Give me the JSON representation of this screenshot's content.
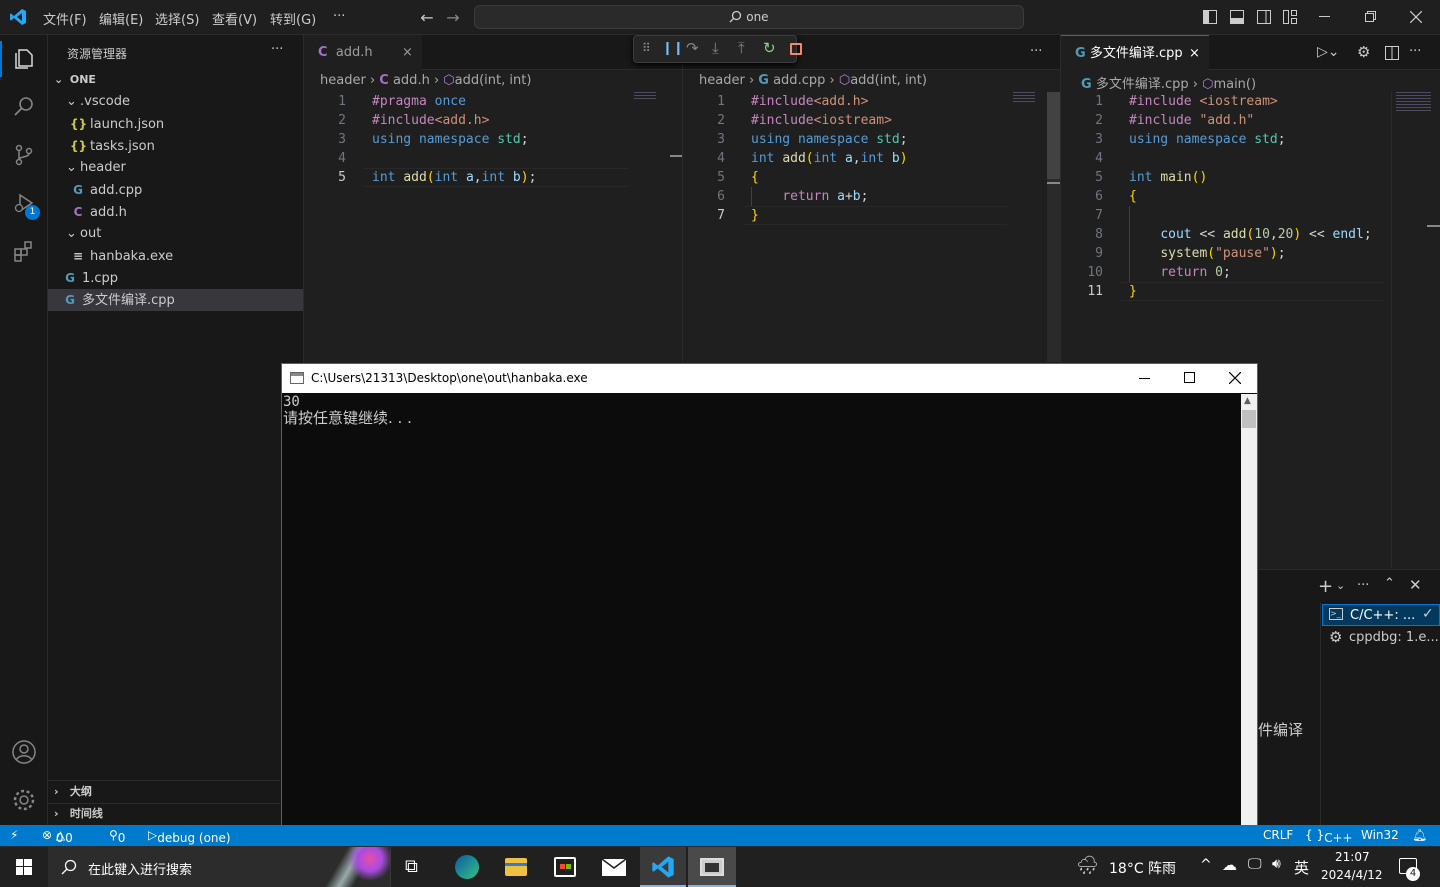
{
  "titlebar": {
    "menus": [
      "文件(F)",
      "编辑(E)",
      "选择(S)",
      "查看(V)",
      "转到(G)"
    ],
    "more": "···",
    "search_text": "one"
  },
  "activity": {
    "debug_badge": "1"
  },
  "sidebar": {
    "title": "资源管理器",
    "more": "···",
    "root": "ONE",
    "items": [
      {
        "label": ".vscode",
        "kind": "folder"
      },
      {
        "label": "launch.json",
        "kind": "json"
      },
      {
        "label": "tasks.json",
        "kind": "json"
      },
      {
        "label": "header",
        "kind": "folder"
      },
      {
        "label": "add.cpp",
        "kind": "cpp"
      },
      {
        "label": "add.h",
        "kind": "c"
      },
      {
        "label": "out",
        "kind": "folder"
      },
      {
        "label": "hanbaka.exe",
        "kind": "exe"
      },
      {
        "label": "1.cpp",
        "kind": "cpp"
      },
      {
        "label": "多文件编译.cpp",
        "kind": "cpp"
      }
    ],
    "outline": "大纲",
    "timeline": "时间线"
  },
  "editor1": {
    "tab": "add.h",
    "crumbs": [
      "header",
      "add.h",
      "add(int, int)"
    ],
    "line_numbers": [
      "1",
      "2",
      "3",
      "4",
      "5"
    ]
  },
  "editor2": {
    "crumbs": [
      "header",
      "add.cpp",
      "add(int, int)"
    ],
    "line_numbers": [
      "1",
      "2",
      "3",
      "4",
      "5",
      "6",
      "7"
    ]
  },
  "editor3": {
    "tab": "多文件编译.cpp",
    "crumbs": [
      "多文件编译.cpp",
      "main()"
    ],
    "line_numbers": [
      "1",
      "2",
      "3",
      "4",
      "5",
      "6",
      "7",
      "8",
      "9",
      "10",
      "11"
    ]
  },
  "code": {
    "e1": [
      "#pragma once",
      "#include<add.h>",
      "using namespace std;",
      "",
      "int add(int a,int b);"
    ],
    "e2": [
      "#include<add.h>",
      "#include<iostream>",
      "using namespace std;",
      "int add(int a,int b)",
      "{",
      "    return a+b;",
      "}"
    ],
    "e3": [
      "#include <iostream>",
      "#include \"add.h\"",
      "using namespace std;",
      "",
      "int main()",
      "{",
      "",
      "    cout << add(10,20) << endl;",
      "    system(\"pause\");",
      "    return 0;",
      "}"
    ]
  },
  "terminal_panel": {
    "items": [
      "C/C++: ...",
      "cppdbg: 1.e..."
    ],
    "hidden_text": "件编译"
  },
  "console": {
    "title": "C:\\Users\\21313\\Desktop\\one\\out\\hanbaka.exe",
    "lines": [
      "30",
      "请按任意键继续. . ."
    ]
  },
  "statusbar": {
    "errors": "0",
    "warnings": "0",
    "ports": "0",
    "debug": "debug (one)",
    "eol": "CRLF",
    "lang": "C++",
    "platform": "Win32"
  },
  "taskbar": {
    "search_placeholder": "在此键入进行搜索",
    "weather": "18°C 阵雨",
    "ime": "英",
    "time": "21:07",
    "date": "2024/4/12",
    "notifications": "4"
  },
  "colors": {
    "accent": "#0078d4",
    "statusbar": "#007acc"
  }
}
